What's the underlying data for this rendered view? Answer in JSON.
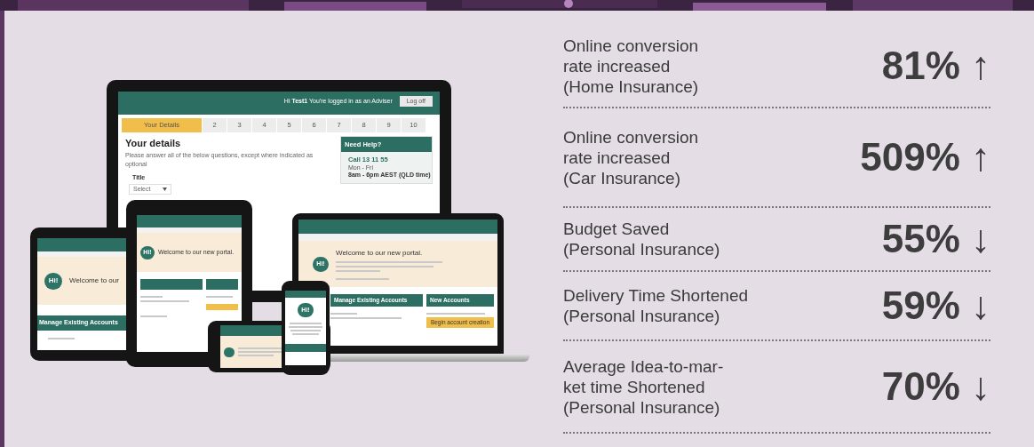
{
  "monitor": {
    "greeting": "Hi **Test1**  You're logged in as an Adviser",
    "logoff": "Log off",
    "steps": [
      {
        "label": "Your Details",
        "selected": true
      },
      {
        "label": "2",
        "selected": false
      },
      {
        "label": "3",
        "selected": false
      },
      {
        "label": "4",
        "selected": false
      },
      {
        "label": "5",
        "selected": false
      },
      {
        "label": "6",
        "selected": false
      },
      {
        "label": "7",
        "selected": false
      },
      {
        "label": "8",
        "selected": false
      },
      {
        "label": "9",
        "selected": false
      },
      {
        "label": "10",
        "selected": false
      }
    ],
    "heading": "Your details",
    "instruction": "Please answer all of the below questions, except where indicated as optional",
    "field_label": "Title",
    "select_value": "Select",
    "help": {
      "title": "Need Help?",
      "phone": "Call 13 11 55",
      "days": "Mon - Fri",
      "hours": "8am - 6pm AEST (QLD time)"
    }
  },
  "laptop": {
    "bubble": "Hi!",
    "welcome": "Welcome to our new portal.",
    "manage": "Manage Existing Accounts",
    "new_accounts": "New Accounts",
    "begin": "Begin account creation"
  },
  "tablet": {
    "bubble": "Hi!",
    "welcome": "Welcome to our",
    "manage": "Manage Existing Accounts"
  },
  "tablet_portrait": {
    "bubble": "Hi!",
    "welcome": "Welcome to our new portal."
  },
  "phone": {
    "bubble": "Hi!"
  },
  "stats": [
    {
      "label": "Online conversion\nrate increased\n(Home Insurance)",
      "value": "81%",
      "arrow": "↑"
    },
    {
      "label": "Online conversion\nrate increased\n (Car Insurance)",
      "value": "509%",
      "arrow": "↑"
    },
    {
      "label": "Budget Saved\n(Personal Insurance)",
      "value": "55%",
      "arrow": "↓"
    },
    {
      "label": "Delivery Time Shortened\n(Personal Insurance)",
      "value": "59%",
      "arrow": "↓"
    },
    {
      "label": "Average Idea-to-mar-\nket time Shortened\n(Personal Insurance)",
      "value": "70%",
      "arrow": "↓"
    }
  ]
}
